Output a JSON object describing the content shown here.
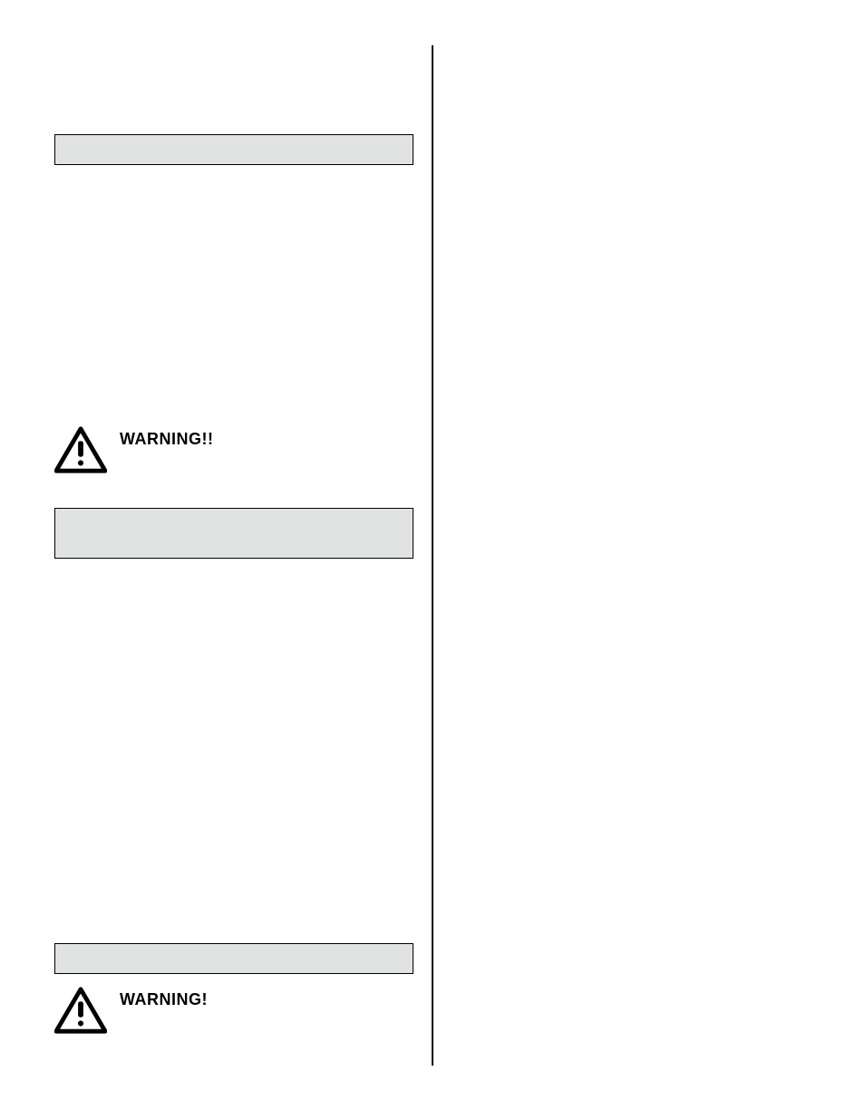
{
  "warnings": {
    "upper_label": "WARNING!!",
    "lower_label": "WARNING!"
  }
}
